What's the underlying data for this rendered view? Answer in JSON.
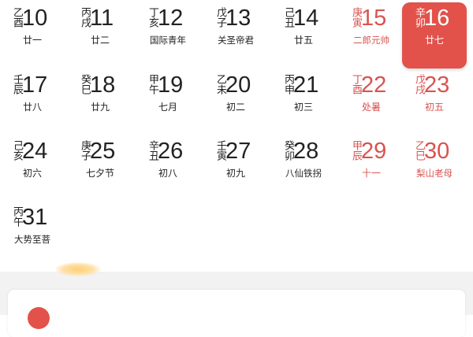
{
  "calendar": {
    "weeks": [
      {
        "days": [
          {
            "ganzhi": "乙酉",
            "date": "10",
            "lunar": "廿一",
            "style": "normal"
          },
          {
            "ganzhi": "丙戌",
            "date": "11",
            "lunar": "廿二",
            "style": "normal"
          },
          {
            "ganzhi": "丁亥",
            "date": "12",
            "lunar": "国际青年",
            "style": "normal"
          },
          {
            "ganzhi": "戊子",
            "date": "13",
            "lunar": "关圣帝君",
            "style": "normal"
          },
          {
            "ganzhi": "己丑",
            "date": "14",
            "lunar": "廿五",
            "style": "normal"
          },
          {
            "ganzhi": "庚寅",
            "date": "15",
            "lunar": "二郎元帅",
            "style": "weekend"
          },
          {
            "ganzhi": "辛卯",
            "date": "16",
            "lunar": "廿七",
            "style": "selected"
          }
        ]
      },
      {
        "days": [
          {
            "ganzhi": "壬辰",
            "date": "17",
            "lunar": "廿八",
            "style": "normal"
          },
          {
            "ganzhi": "癸巳",
            "date": "18",
            "lunar": "廿九",
            "style": "normal"
          },
          {
            "ganzhi": "甲午",
            "date": "19",
            "lunar": "七月",
            "style": "normal"
          },
          {
            "ganzhi": "乙未",
            "date": "20",
            "lunar": "初二",
            "style": "normal"
          },
          {
            "ganzhi": "丙申",
            "date": "21",
            "lunar": "初三",
            "style": "normal"
          },
          {
            "ganzhi": "丁酉",
            "date": "22",
            "lunar": "处暑",
            "style": "weekend"
          },
          {
            "ganzhi": "戊戌",
            "date": "23",
            "lunar": "初五",
            "style": "weekend"
          }
        ]
      },
      {
        "days": [
          {
            "ganzhi": "己亥",
            "date": "24",
            "lunar": "初六",
            "style": "normal"
          },
          {
            "ganzhi": "庚子",
            "date": "25",
            "lunar": "七夕节",
            "style": "normal"
          },
          {
            "ganzhi": "辛丑",
            "date": "26",
            "lunar": "初八",
            "style": "normal"
          },
          {
            "ganzhi": "壬寅",
            "date": "27",
            "lunar": "初九",
            "style": "normal"
          },
          {
            "ganzhi": "癸卯",
            "date": "28",
            "lunar": "八仙铁拐",
            "style": "normal"
          },
          {
            "ganzhi": "甲辰",
            "date": "29",
            "lunar": "十一",
            "style": "weekend"
          },
          {
            "ganzhi": "乙巳",
            "date": "30",
            "lunar": "梨山老母",
            "style": "weekend"
          }
        ]
      },
      {
        "days": [
          {
            "ganzhi": "丙午",
            "date": "31",
            "lunar": "大势至菩",
            "style": "normal"
          }
        ]
      }
    ]
  },
  "colors": {
    "accent": "#e2524b",
    "weekend_text": "#d9534f",
    "normal_text": "#222222",
    "footer_bg": "#f2f2f2"
  }
}
